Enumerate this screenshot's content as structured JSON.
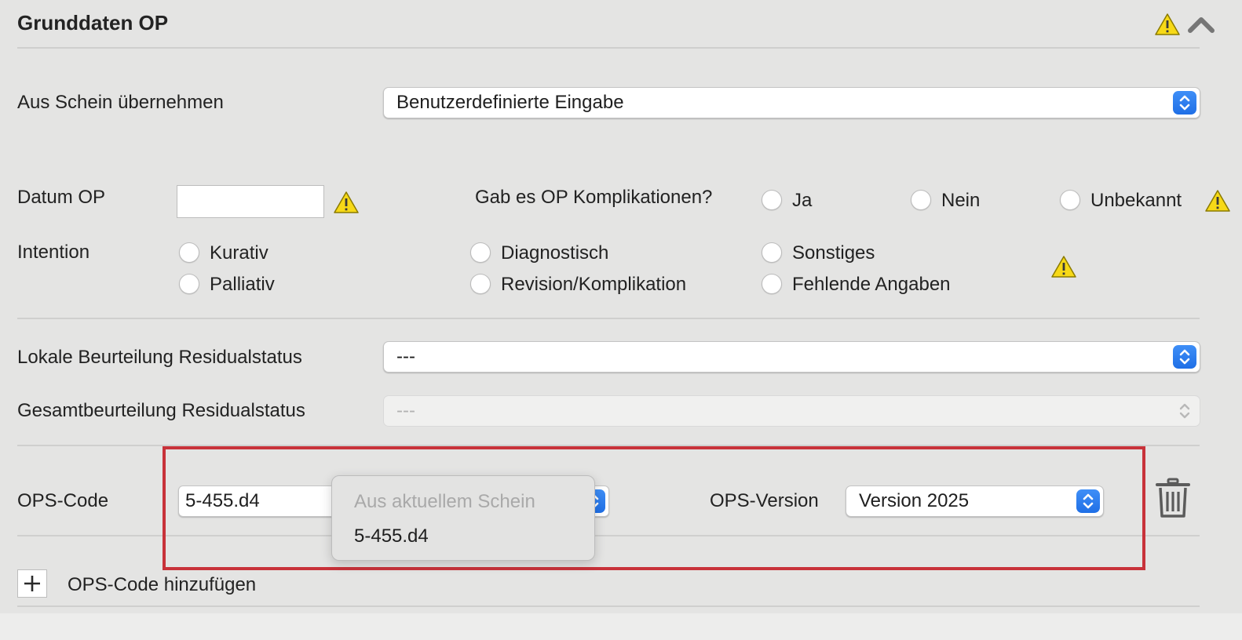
{
  "section": {
    "title": "Grunddaten OP"
  },
  "aus_schein": {
    "label": "Aus Schein übernehmen",
    "value": "Benutzerdefinierte Eingabe"
  },
  "datum": {
    "label": "Datum OP",
    "value": ""
  },
  "komplikationen": {
    "question": "Gab es OP Komplikationen?",
    "options": [
      "Ja",
      "Nein",
      "Unbekannt"
    ]
  },
  "intention": {
    "label": "Intention",
    "options": [
      "Kurativ",
      "Palliativ",
      "Diagnostisch",
      "Revision/Komplikation",
      "Sonstiges",
      "Fehlende Angaben"
    ]
  },
  "lokale": {
    "label": "Lokale Beurteilung Residualstatus",
    "value": "---"
  },
  "gesamt": {
    "label": "Gesamtbeurteilung Residualstatus",
    "value": "---"
  },
  "ops": {
    "code_label": "OPS-Code",
    "code_value": "5-455.d4",
    "version_label": "OPS-Version",
    "version_value": "Version 2025",
    "add_label": "OPS-Code hinzufügen"
  },
  "dropdown_menu": {
    "header": "Aus aktuellem Schein",
    "items": [
      "5-455.d4"
    ]
  },
  "colors": {
    "accent": "#2a7bf0",
    "warning": "#f7d917",
    "highlight_border": "#c8323a"
  },
  "icons": [
    "warning-icon",
    "chevron-up-icon",
    "trash-icon",
    "plus-icon"
  ]
}
